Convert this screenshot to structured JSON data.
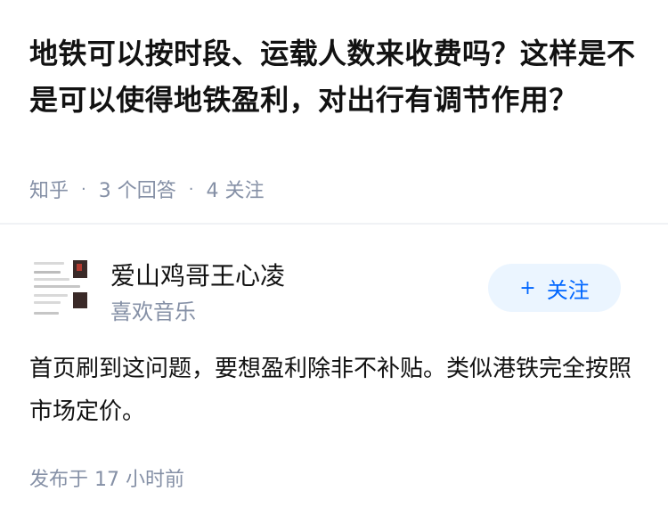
{
  "question": {
    "title": "地铁可以按时段、运载人数来收费吗？这样是不是可以使得地铁盈利，对出行有调节作用？",
    "source": "知乎",
    "answers_count": "3 个回答",
    "followers_count": "4 关注"
  },
  "answer": {
    "author_name": "爱山鸡哥王心凌",
    "author_bio": "喜欢音乐",
    "follow_label": "关注",
    "follow_icon": "plus-icon",
    "content": "首页刷到这问题，要想盈利除非不补贴。类似港铁完全按照市场定价。",
    "published_time": "发布于 17 小时前"
  },
  "colors": {
    "title_text": "#121212",
    "meta_text": "#8590a6",
    "follow_bg": "#ebf5ff",
    "follow_text": "#0066ff",
    "divider": "#f0f2f5"
  }
}
